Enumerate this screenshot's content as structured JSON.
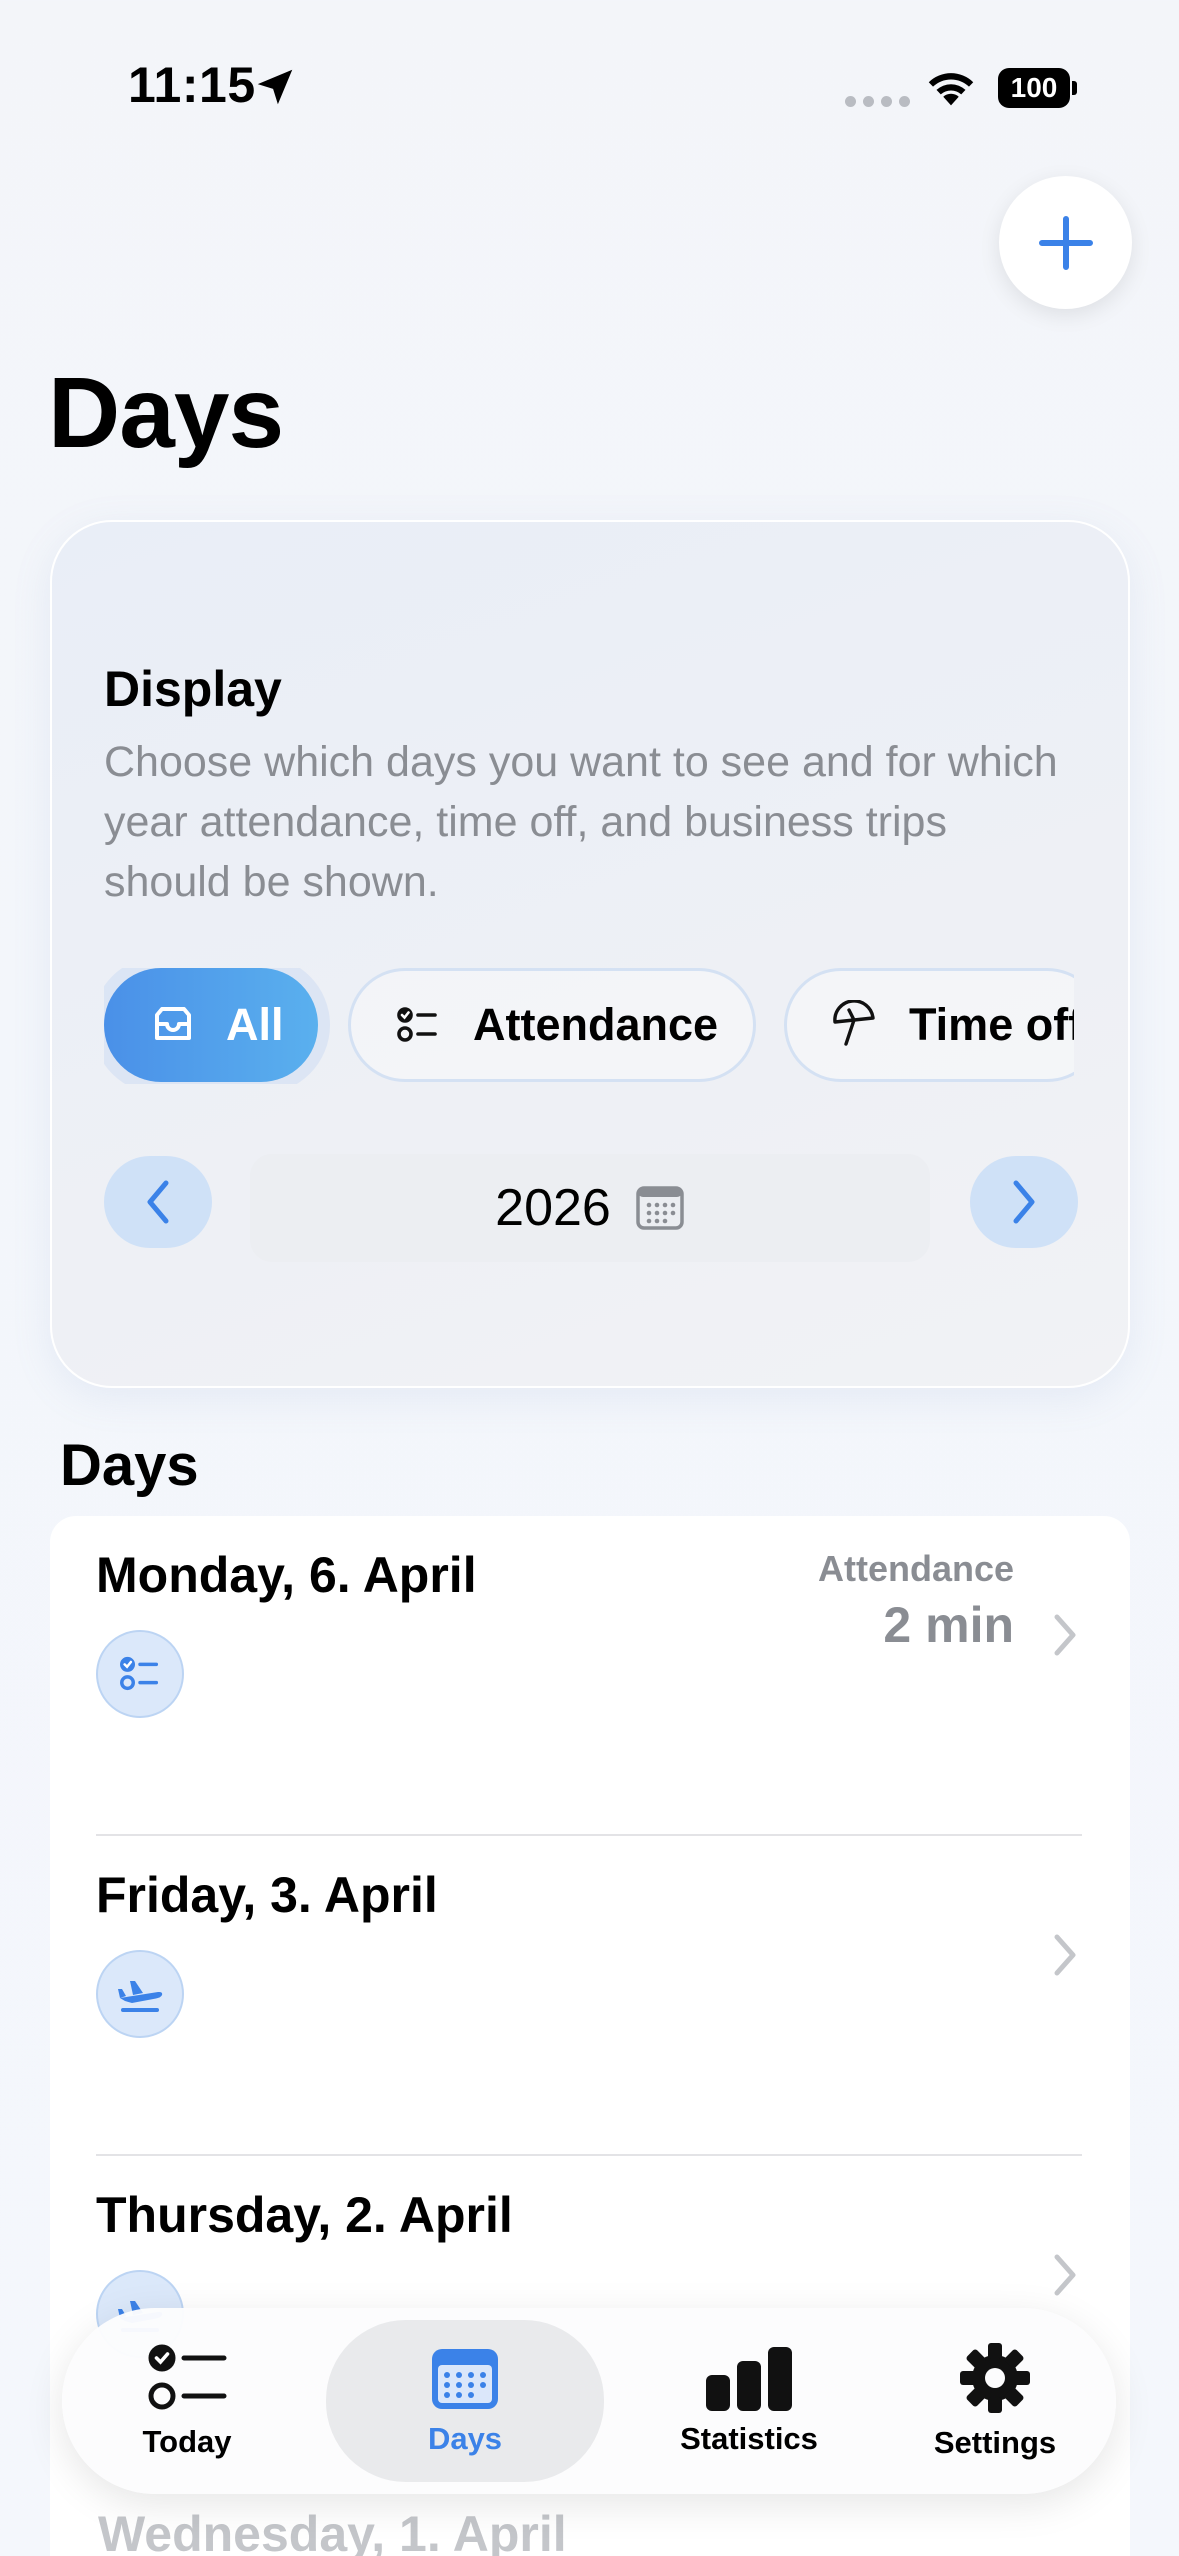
{
  "status_bar": {
    "time": "11:15",
    "battery": "100"
  },
  "page": {
    "title": "Days"
  },
  "display_card": {
    "title": "Display",
    "description": "Choose which days you want to see and for which year attendance, time off, and business trips should be shown.",
    "filters": [
      {
        "label": "All",
        "icon": "tray-icon",
        "selected": true
      },
      {
        "label": "Attendance",
        "icon": "checklist-icon",
        "selected": false
      },
      {
        "label": "Time off",
        "icon": "umbrella-icon",
        "selected": false
      }
    ],
    "year": "2026"
  },
  "days_section": {
    "title": "Days",
    "items": [
      {
        "date": "Monday, 6. April",
        "type": "Attendance",
        "duration": "2 min",
        "icon": "checklist-icon"
      },
      {
        "date": "Friday, 3. April",
        "icon": "airplane-icon"
      },
      {
        "date": "Thursday, 2. April",
        "icon": "airplane-icon"
      },
      {
        "date": "Wednesday, 1. April"
      }
    ]
  },
  "tab_bar": {
    "tabs": [
      {
        "label": "Today",
        "icon": "checklist-icon"
      },
      {
        "label": "Days",
        "icon": "calendar-icon",
        "active": true
      },
      {
        "label": "Statistics",
        "icon": "bar-chart-icon"
      },
      {
        "label": "Settings",
        "icon": "gear-icon"
      }
    ]
  },
  "colors": {
    "accent": "#3b82e8",
    "chip_gradient_start": "#4a90e8",
    "chip_gradient_end": "#5ab0ee",
    "secondary_text": "#8a8d93"
  }
}
